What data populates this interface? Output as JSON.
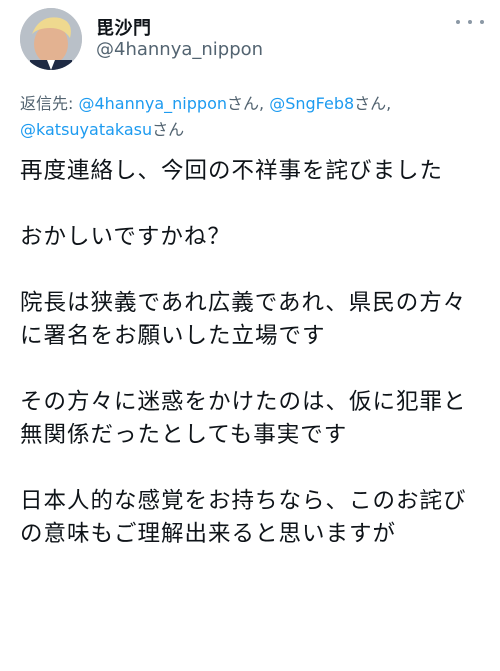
{
  "tweet": {
    "author_name": "毘沙門",
    "author_handle": "@4hannya_nippon",
    "more_icon": "more-horizontal-icon",
    "reply_prefix": "返信先: ",
    "reply_targets": [
      {
        "handle": "@4hannya_nippon",
        "suffix": "さん, "
      },
      {
        "handle": "@SngFeb8",
        "suffix": "さん,"
      },
      {
        "handle": "@katsuyatakasu",
        "suffix": "さん"
      }
    ],
    "paragraphs": [
      "再度連絡し、今回の不祥事を詫びました",
      "おかしいですかね？",
      "院長は狭義であれ広義であれ、県民の方々に署名をお願いした立場です",
      "その方々に迷惑をかけたのは、仮に犯罪と無関係だったとしても事実です",
      "日本人的な感覚をお持ちなら、このお詫びの意味もご理解出来ると思いますが"
    ],
    "colors": {
      "text": "#0f1419",
      "secondary": "#536471",
      "link": "#1d9bf0"
    }
  }
}
